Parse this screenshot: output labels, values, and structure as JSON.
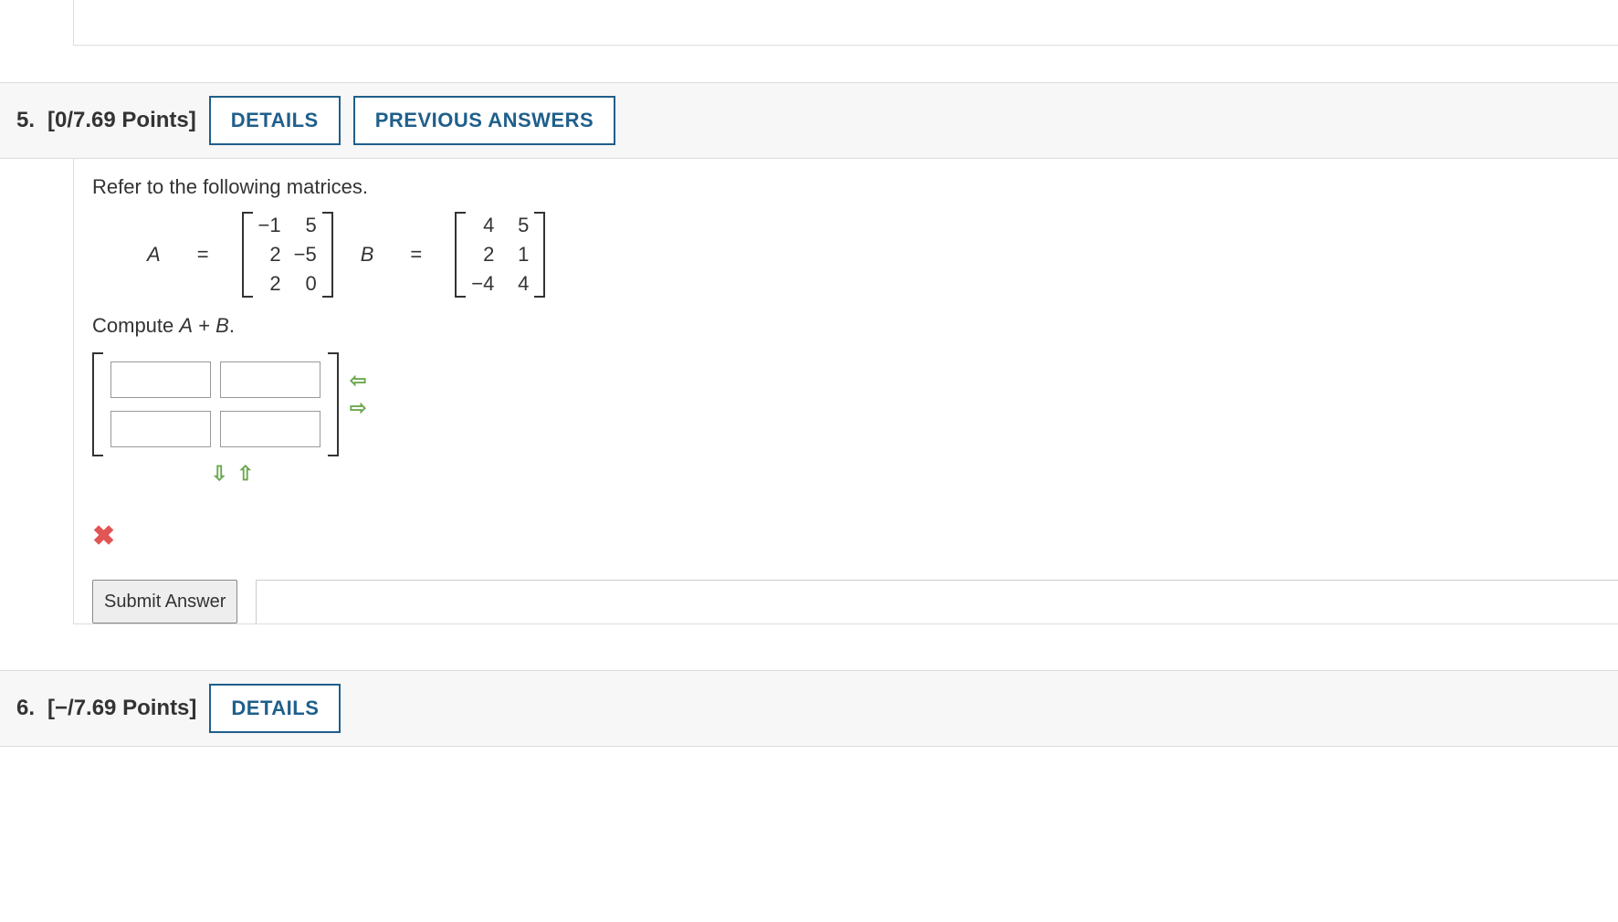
{
  "question5": {
    "number": "5.",
    "points": "[0/7.69 Points]",
    "buttons": {
      "details": "DETAILS",
      "previous": "PREVIOUS ANSWERS"
    },
    "prompt": "Refer to the following matrices.",
    "matrixA": {
      "label": "A",
      "rows": [
        [
          "−1",
          "5"
        ],
        [
          "2",
          "−5"
        ],
        [
          "2",
          "0"
        ]
      ]
    },
    "matrixB": {
      "label": "B",
      "rows": [
        [
          "4",
          "5"
        ],
        [
          "2",
          "1"
        ],
        [
          "−4",
          "4"
        ]
      ]
    },
    "compute_prefix": "Compute ",
    "compute_expr_a": "A",
    "compute_plus": " + ",
    "compute_expr_b": "B",
    "compute_suffix": ".",
    "answer_grid": {
      "rows": 2,
      "cols": 2
    },
    "incorrect_mark": "✖",
    "submit_label": "Submit Answer"
  },
  "question6": {
    "number": "6.",
    "points": "[−/7.69 Points]",
    "buttons": {
      "details": "DETAILS"
    }
  }
}
